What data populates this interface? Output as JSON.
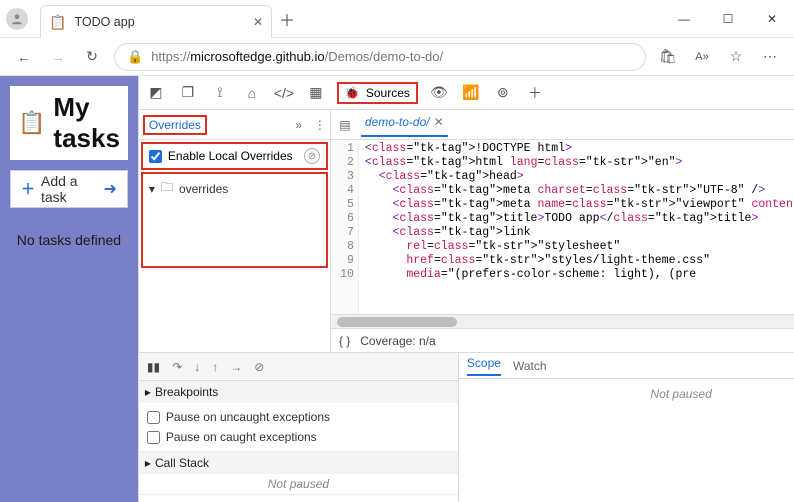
{
  "browser": {
    "tab_title": "TODO app",
    "favicon": "📋",
    "url_prefix": "https://",
    "url_host_path": "microsoftedge.github.io",
    "url_rest": "/Demos/demo-to-do/"
  },
  "app": {
    "title": "My tasks",
    "icon": "📋",
    "add_placeholder": "Add a task",
    "empty_msg": "No tasks defined",
    "plus": "＋",
    "go": "➜"
  },
  "devtools": {
    "sources_label": "Sources",
    "overrides_tab": "Overrides",
    "enable_overrides_label": "Enable Local Overrides",
    "enable_overrides_checked": true,
    "overrides_folder": "overrides",
    "file_tab": "demo-to-do/",
    "coverage_label": "Coverage: n/a",
    "braces": "{ }",
    "code": {
      "line_numbers": [
        "1",
        "2",
        "3",
        "4",
        "5",
        "6",
        "7",
        "8",
        "9",
        "10"
      ],
      "lines": [
        {
          "indent": 0,
          "raw": "<!DOCTYPE html>"
        },
        {
          "indent": 0,
          "raw": "<html lang=\"en\">"
        },
        {
          "indent": 1,
          "raw": "<head>"
        },
        {
          "indent": 2,
          "raw": "<meta charset=\"UTF-8\" />"
        },
        {
          "indent": 2,
          "raw": "<meta name=\"viewport\" content=\"width=device-"
        },
        {
          "indent": 2,
          "raw": "<title>TODO app</title>"
        },
        {
          "indent": 2,
          "raw": "<link"
        },
        {
          "indent": 3,
          "raw": "rel=\"stylesheet\""
        },
        {
          "indent": 3,
          "raw": "href=\"styles/light-theme.css\""
        },
        {
          "indent": 3,
          "raw": "media=\"(prefers-color-scheme: light), (pre"
        }
      ]
    },
    "debugger": {
      "breakpoints_header": "Breakpoints",
      "pause_uncaught": "Pause on uncaught exceptions",
      "pause_caught": "Pause on caught exceptions",
      "callstack_header": "Call Stack",
      "not_paused": "Not paused"
    },
    "scope": {
      "scope_tab": "Scope",
      "watch_tab": "Watch",
      "not_paused": "Not paused"
    }
  }
}
